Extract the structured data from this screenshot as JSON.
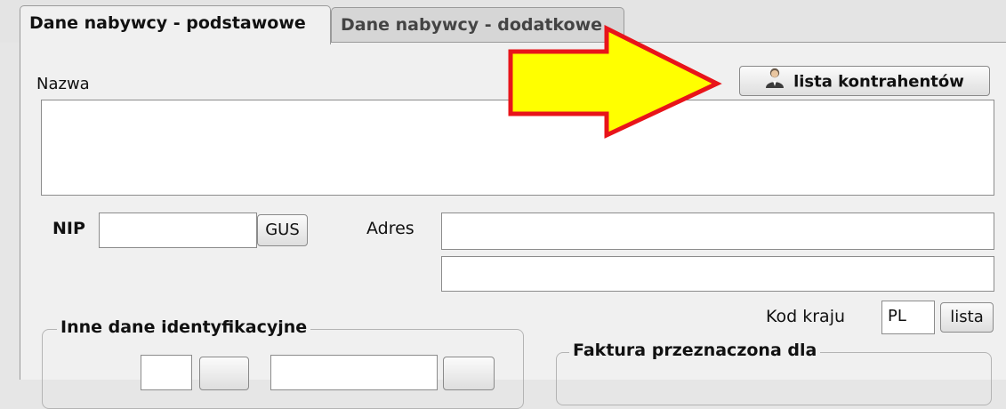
{
  "tabs": [
    {
      "label": "Dane nabywcy - podstawowe",
      "active": true
    },
    {
      "label": "Dane nabywcy - dodatkowe",
      "active": false
    }
  ],
  "form": {
    "nazwa_label": "Nazwa",
    "nazwa_value": "",
    "lista_kontrahentow_label": "lista kontrahentów",
    "nip_label": "NIP",
    "nip_value": "",
    "gus_label": "GUS",
    "adres_label": "Adres",
    "adres_line1_value": "",
    "adres_line2_value": "",
    "kod_kraju_label": "Kod kraju",
    "kod_kraju_value": "PL",
    "lista_label": "lista",
    "inne_dane_title": "Inne dane identyfikacyjne",
    "faktura_title": "Faktura przeznaczona dla"
  },
  "icons": {
    "contacts_button_icon": "person-icon"
  },
  "colors": {
    "arrow_fill": "#ffff00",
    "arrow_stroke": "#e8141a",
    "panel_bg": "#f0f0f0"
  }
}
